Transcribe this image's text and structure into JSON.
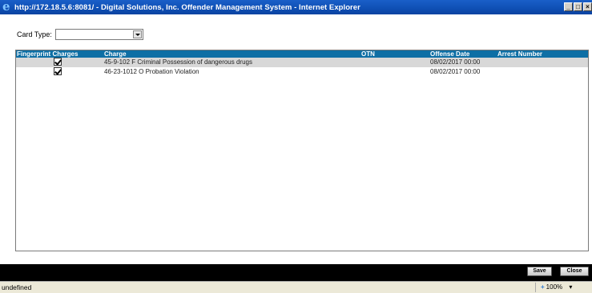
{
  "window": {
    "title": "http://172.18.5.6:8081/ - Digital Solutions, Inc. Offender Management System - Internet Explorer"
  },
  "card_type": {
    "label": "Card Type:",
    "value": ""
  },
  "grid": {
    "headers": [
      "Fingerprint Charges",
      "Charge",
      "OTN",
      "Offense Date",
      "Arrest Number"
    ],
    "rows": [
      {
        "checked": true,
        "charge": "45-9-102 F Criminal Possession of dangerous drugs",
        "otn": "",
        "offense_date": "08/02/2017 00:00",
        "arrest_number": ""
      },
      {
        "checked": true,
        "charge": "46-23-1012 O Probation Violation",
        "otn": "",
        "offense_date": "08/02/2017 00:00",
        "arrest_number": ""
      }
    ]
  },
  "buttons": {
    "save": "Save",
    "close": "Close"
  },
  "status": {
    "text": "undefined",
    "zoom": "100%"
  }
}
